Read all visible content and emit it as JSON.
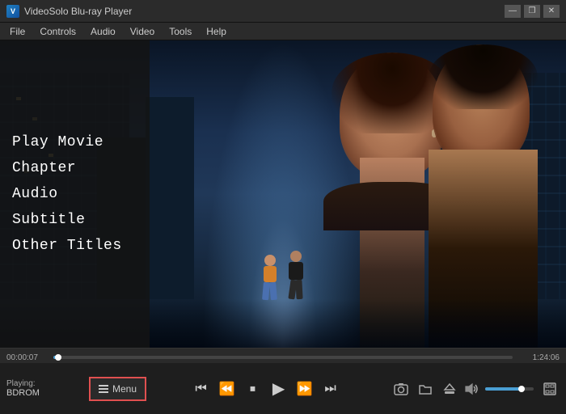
{
  "titlebar": {
    "app_name": "VideoSolo Blu-ray Player",
    "minimize_label": "—",
    "restore_label": "❐",
    "close_label": "✕"
  },
  "menubar": {
    "items": [
      {
        "id": "file",
        "label": "File"
      },
      {
        "id": "controls",
        "label": "Controls"
      },
      {
        "id": "audio",
        "label": "Audio"
      },
      {
        "id": "video",
        "label": "Video"
      },
      {
        "id": "tools",
        "label": "Tools"
      },
      {
        "id": "help",
        "label": "Help"
      }
    ]
  },
  "overlay_menu": {
    "items": [
      {
        "id": "play-movie",
        "label": "Play Movie"
      },
      {
        "id": "chapter",
        "label": "Chapter"
      },
      {
        "id": "audio",
        "label": "Audio"
      },
      {
        "id": "subtitle",
        "label": "Subtitle"
      },
      {
        "id": "other-titles",
        "label": "Other Titles"
      }
    ]
  },
  "progress": {
    "time_left": "00:00:07",
    "time_right": "1:24:06",
    "fill_percent": 1
  },
  "controls": {
    "playing_label": "Playing:",
    "playing_value": "BDROM",
    "menu_button_label": "Menu",
    "transport": {
      "skip_back": "⏮",
      "rewind": "⏪",
      "stop": "⏹",
      "play": "▶",
      "fast_forward": "⏩",
      "skip_next": "⏭"
    },
    "right": {
      "screenshot": "📷",
      "open_file": "📁",
      "eject": "⏏"
    },
    "volume_icon": "🔊"
  }
}
